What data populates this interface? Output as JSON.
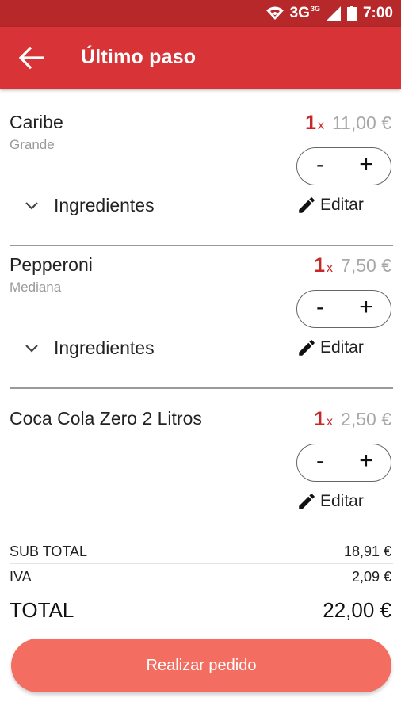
{
  "status_bar": {
    "network": "3G",
    "network_sup": "3G",
    "time": "7:00"
  },
  "header": {
    "title": "Último paso"
  },
  "items": [
    {
      "name": "Caribe",
      "size": "Grande",
      "qty": "1",
      "times": "x",
      "price": "11,00 €",
      "minus": "-",
      "plus": "+",
      "ingredients_label": "Ingredientes",
      "edit_label": "Editar"
    },
    {
      "name": "Pepperoni",
      "size": "Mediana",
      "qty": "1",
      "times": "x",
      "price": "7,50 €",
      "minus": "-",
      "plus": "+",
      "ingredients_label": "Ingredientes",
      "edit_label": "Editar"
    },
    {
      "name": "Coca Cola Zero 2 Litros",
      "qty": "1",
      "times": "x",
      "price": "2,50 €",
      "minus": "-",
      "plus": "+",
      "edit_label": "Editar"
    }
  ],
  "summary": {
    "subtotal_label": "SUB TOTAL",
    "subtotal_value": "18,91 €",
    "iva_label": "IVA",
    "iva_value": "2,09 €",
    "total_label": "TOTAL",
    "total_value": "22,00 €"
  },
  "action": {
    "place_order_label": "Realizar pedido"
  },
  "colors": {
    "status_bar": "#b7282a",
    "app_bar": "#d83337",
    "accent": "#c62828",
    "cta": "#f36d60"
  }
}
